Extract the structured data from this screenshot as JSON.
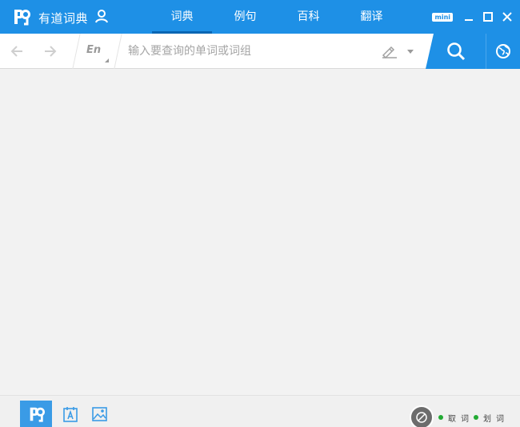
{
  "app": {
    "title": "有道词典"
  },
  "tabs": [
    {
      "label": "词典",
      "active": true
    },
    {
      "label": "例句",
      "active": false
    },
    {
      "label": "百科",
      "active": false
    },
    {
      "label": "翻译",
      "active": false
    }
  ],
  "window_controls": {
    "mini_label": "mini"
  },
  "search": {
    "language": "En",
    "placeholder": "输入要查询的单词或词组",
    "value": ""
  },
  "bottom": {
    "right_text_1": "取",
    "right_text_2": "词",
    "right_text_3": "划",
    "right_text_4": "词"
  },
  "colors": {
    "accent": "#1e90e6",
    "background": "#f2f2f2"
  },
  "icons": [
    "youdao-logo-icon",
    "user-icon",
    "minimize-icon",
    "maximize-icon",
    "close-icon",
    "back-arrow-icon",
    "forward-arrow-icon",
    "handwriting-pen-icon",
    "search-icon",
    "globe-icon",
    "word-lookup-icon",
    "text-ocr-icon",
    "image-translate-icon"
  ]
}
